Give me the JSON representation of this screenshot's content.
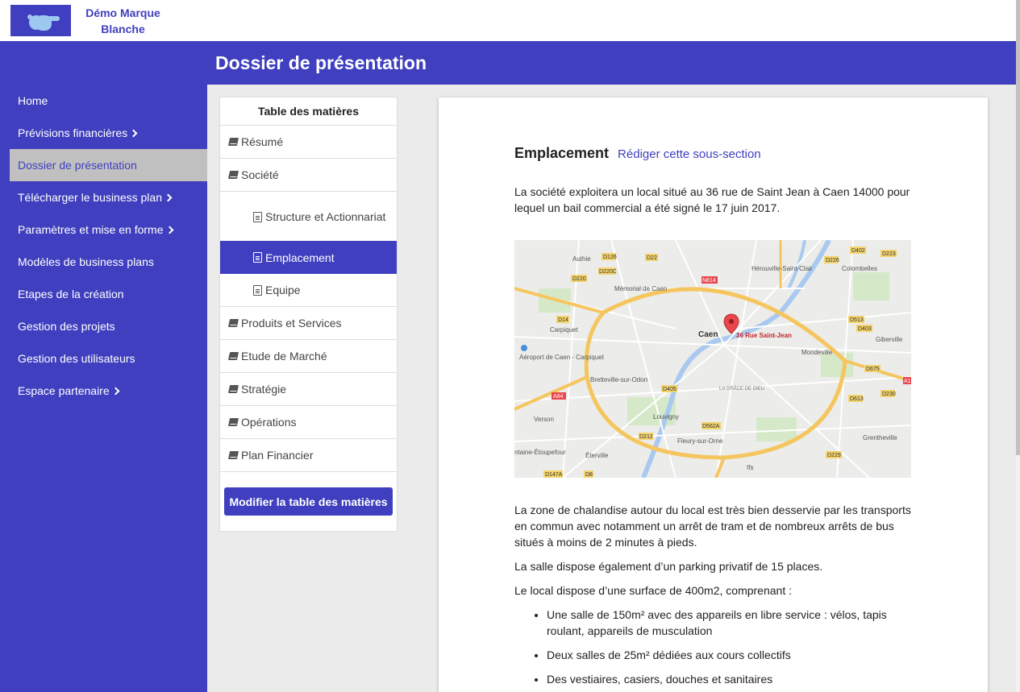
{
  "brand": {
    "name": "Démo Marque Blanche"
  },
  "sidebar": {
    "items": [
      {
        "label": "Home",
        "chevron": false,
        "active": false
      },
      {
        "label": "Prévisions financières",
        "chevron": true,
        "active": false
      },
      {
        "label": "Dossier de présentation",
        "chevron": false,
        "active": true
      },
      {
        "label": "Télécharger le business plan",
        "chevron": true,
        "active": false
      },
      {
        "label": "Paramètres et mise en forme",
        "chevron": true,
        "active": false
      },
      {
        "label": "Modèles de business plans",
        "chevron": false,
        "active": false
      },
      {
        "label": "Etapes de la création",
        "chevron": false,
        "active": false
      },
      {
        "label": "Gestion des projets",
        "chevron": false,
        "active": false
      },
      {
        "label": "Gestion des utilisateurs",
        "chevron": false,
        "active": false
      },
      {
        "label": "Espace partenaire",
        "chevron": true,
        "active": false
      }
    ]
  },
  "header": {
    "title": "Dossier de présentation"
  },
  "toc": {
    "title": "Table des matières",
    "items": [
      {
        "label": "Résumé",
        "level": 1
      },
      {
        "label": "Société",
        "level": 1
      },
      {
        "label": "Structure et Actionnariat",
        "level": 2
      },
      {
        "label": "Emplacement",
        "level": 2,
        "active": true
      },
      {
        "label": "Equipe",
        "level": 2
      },
      {
        "label": "Produits et Services",
        "level": 1
      },
      {
        "label": "Etude de Marché",
        "level": 1
      },
      {
        "label": "Stratégie",
        "level": 1
      },
      {
        "label": "Opérations",
        "level": 1
      },
      {
        "label": "Plan Financier",
        "level": 1
      }
    ],
    "edit_button": "Modifier la table des matières"
  },
  "content": {
    "section_title": "Emplacement",
    "edit_link": "Rédiger cette sous-section",
    "intro": "La société exploitera un local situé au 36 rue de Saint Jean à Caen 14000 pour lequel un bail commercial a été signé le 17 juin 2017.",
    "map": {
      "marker_label": "36 Rue Saint-Jean",
      "places": [
        "Caen",
        "Authie",
        "Mémorial de Caen",
        "Hérouville-Saint-Clair",
        "Colombelles",
        "Carpiquet",
        "Aéroport de Caen - Carpiquet",
        "Bretteville-sur-Odon",
        "Mondeville",
        "Giberville",
        "Louvigny",
        "Verson",
        "Fleury-sur-Orne",
        "Grentheville",
        "Éterville",
        "Ifs",
        "LA GRÂCE DE DIEU",
        "ntaine-Étoupefour"
      ],
      "roads": [
        "N814",
        "D126",
        "D22",
        "D220C",
        "D220",
        "D226",
        "D402",
        "D223",
        "D14",
        "D513",
        "D403",
        "D675",
        "A84",
        "D405",
        "D562A",
        "D212",
        "D613",
        "D230",
        "D229",
        "D147A",
        "D8",
        "A1"
      ]
    },
    "paragraphs": [
      "La zone de chalandise autour du local est très bien desservie par les transports en commun avec notamment un arrêt de tram et de nombreux arrêts de bus situés à moins de 2 minutes à pieds.",
      "La salle dispose également d’un parking privatif de 15 places.",
      "Le local dispose d’une surface de 400m2, comprenant :"
    ],
    "bullets": [
      "Une salle de 150m² avec des appareils en libre service : vélos, tapis roulant, appareils de musculation",
      "Deux salles de 25m² dédiées aux cours collectifs",
      "Des vestiaires, casiers, douches et sanitaires"
    ]
  },
  "colors": {
    "primary": "#3f3fbf",
    "active_nav_bg": "#c0c0c0",
    "page_bg": "#ebebeb"
  }
}
